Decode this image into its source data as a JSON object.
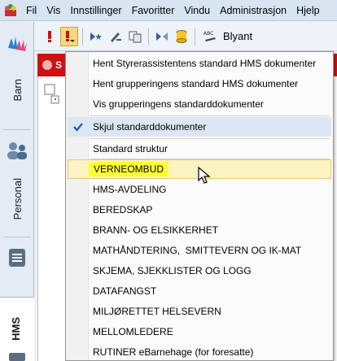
{
  "menubar": {
    "items": [
      "Fil",
      "Vis",
      "Innstillinger",
      "Favoritter",
      "Vindu",
      "Administrasjon",
      "Hjelp"
    ]
  },
  "sidebar": {
    "tabs": [
      "Barn",
      "Personal",
      "HMS"
    ]
  },
  "toolbar": {
    "blyant_label": "Blyant"
  },
  "panel": {
    "header_letter": "S"
  },
  "dropdown": {
    "items": [
      "Hent Styrerassistentens standard HMS dokumenter",
      "Hent grupperingens standard HMS dokumenter",
      "Vis grupperingens standarddokumenter",
      "Skjul standarddokumenter",
      "Standard struktur",
      "VERNEOMBUD",
      "HMS-AVDELING",
      "BEREDSKAP",
      "BRANN- OG ELSIKKERHET",
      "MATHÅNDTERING,  SMITTEVERN OG IK-MAT",
      "SKJEMA, SJEKKLISTER OG LOGG",
      "DATAFANGST",
      "MILJØRETTET HELSEVERN",
      "MELLOMLEDERE",
      "RUTINER eBarnehage (for foresatte)"
    ],
    "checked_item": "Skjul standarddokumenter",
    "hover_item": "VERNEOMBUD"
  },
  "colors": {
    "accent_red": "#cc1111",
    "highlight_yellow": "#ffff33",
    "menubar_bg": "#d7e4f2"
  }
}
